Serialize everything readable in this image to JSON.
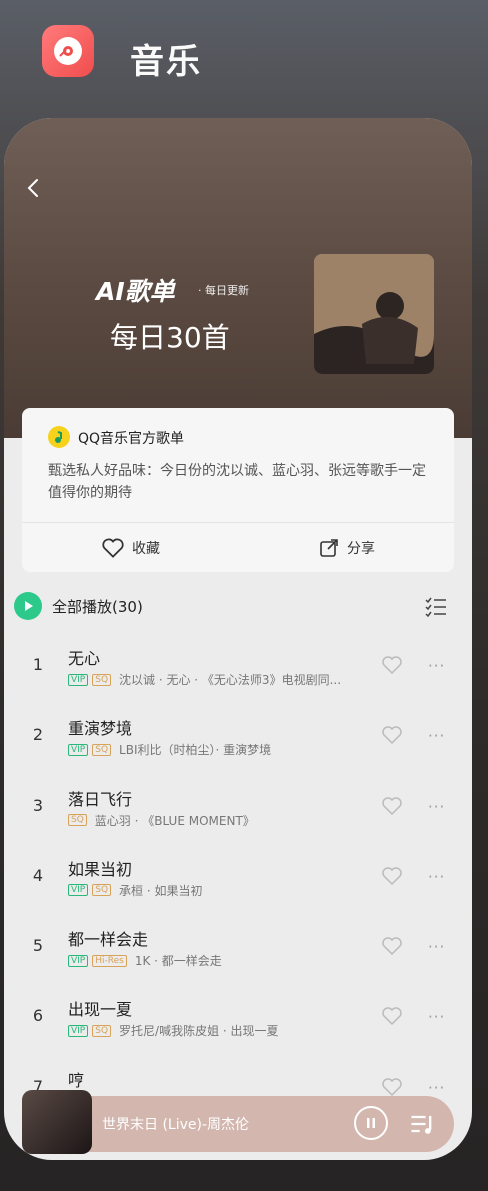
{
  "app": {
    "title": "音乐",
    "icon": "music-disc-icon"
  },
  "colors": {
    "accent": "#2cc98a",
    "vip": "#2cb77a",
    "sq": "#d7a25a",
    "app_icon": "#f04d4d"
  },
  "hero": {
    "ai_label": "AI歌单",
    "update_label": "· 每日更新",
    "daily_title": "每日30首"
  },
  "info": {
    "official_label": "QQ音乐官方歌单",
    "description": "甄选私人好品味：今日份的沈以诚、蓝心羽、张远等歌手一定值得你的期待",
    "collect_label": "收藏",
    "share_label": "分享"
  },
  "playall": {
    "label": "全部播放(30)"
  },
  "songs": [
    {
      "no": "1",
      "title": "无心",
      "tags": [
        "VIP",
        "SQ"
      ],
      "meta": "沈以诚 · 无心 · 《无心法师3》电视剧同..."
    },
    {
      "no": "2",
      "title": "重演梦境",
      "tags": [
        "VIP",
        "SQ"
      ],
      "meta": "LBI利比（时柏尘）· 重演梦境"
    },
    {
      "no": "3",
      "title": "落日飞行",
      "tags": [
        "SQ"
      ],
      "meta": "蓝心羽 · 《BLUE MOMENT》"
    },
    {
      "no": "4",
      "title": "如果当初",
      "tags": [
        "VIP",
        "SQ"
      ],
      "meta": "承桓 · 如果当初"
    },
    {
      "no": "5",
      "title": "都一样会走",
      "tags": [
        "VIP",
        "Hi-Res"
      ],
      "meta": "1K · 都一样会走"
    },
    {
      "no": "6",
      "title": "出现一夏",
      "tags": [
        "VIP",
        "SQ"
      ],
      "meta": "罗托尼/喊我陈皮姐 · 出现一夏"
    },
    {
      "no": "7",
      "title": "哼",
      "tags": [],
      "meta": ""
    }
  ],
  "player": {
    "title": "世界末日 (Live)-周杰伦"
  }
}
